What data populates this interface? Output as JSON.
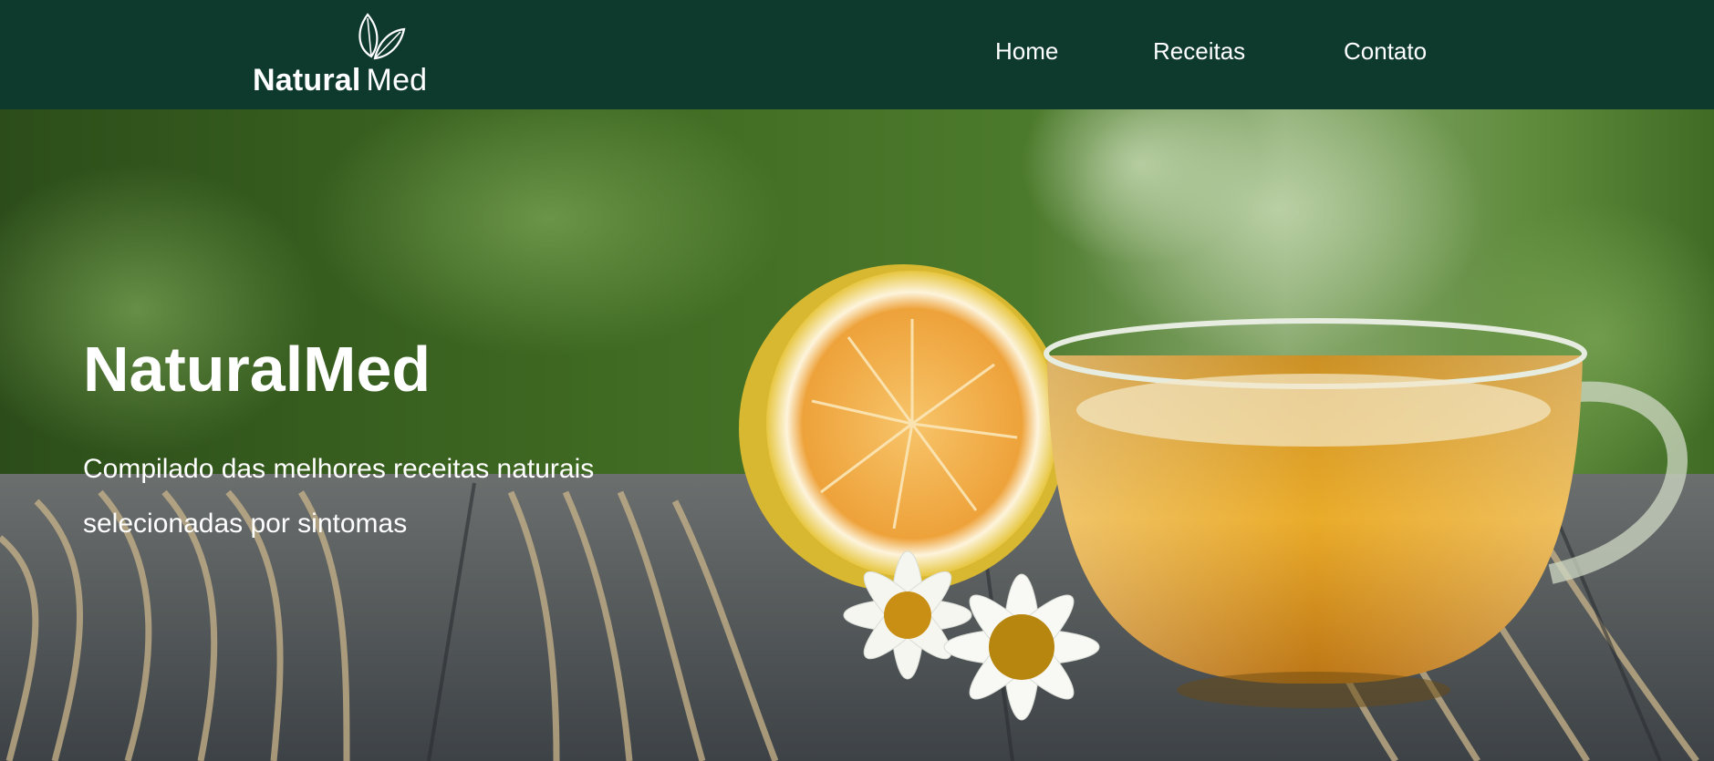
{
  "brand": {
    "name_bold": "Natural",
    "name_light": "Med",
    "logo_icon": "leaves-icon"
  },
  "nav": {
    "items": [
      {
        "label": "Home"
      },
      {
        "label": "Receitas"
      },
      {
        "label": "Contato"
      }
    ]
  },
  "hero": {
    "title": "NaturalMed",
    "subtitle": "Compilado das melhores receitas naturais selecionadas por sintomas",
    "image_description_icon": "tea-cup-lemon-chamomile-image"
  },
  "colors": {
    "header_bg": "#0e3a2e",
    "text": "#ffffff",
    "tea": "#d4900c",
    "wood": "#5b6268"
  }
}
